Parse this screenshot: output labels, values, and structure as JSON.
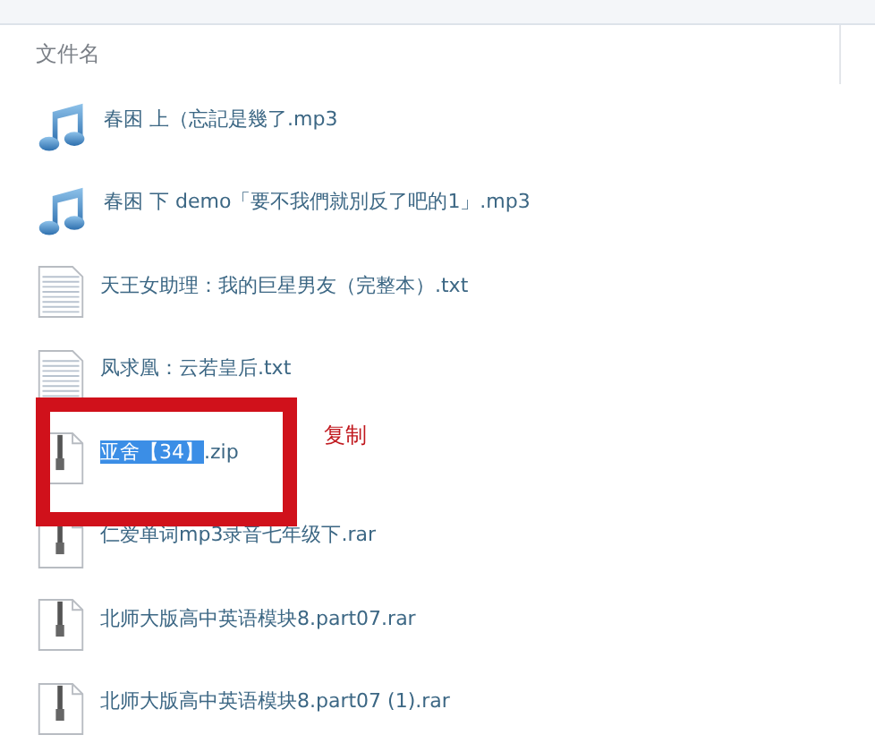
{
  "table": {
    "columns": [
      {
        "label": "文件名"
      }
    ],
    "rows": [
      {
        "kind": "audio",
        "parts": [
          {
            "text": "春困 上（忘記是幾了.mp3",
            "highlighted": false
          }
        ]
      },
      {
        "kind": "audio",
        "parts": [
          {
            "text": "春困 下 demo「要不我們就別反了吧的1」.mp3",
            "highlighted": false
          }
        ]
      },
      {
        "kind": "text",
        "parts": [
          {
            "text": "天王女助理：我的巨星男友（完整本）.txt",
            "highlighted": false
          }
        ]
      },
      {
        "kind": "text",
        "parts": [
          {
            "text": "凤求凰：云若皇后.txt",
            "highlighted": false
          }
        ]
      },
      {
        "kind": "archive",
        "parts": [
          {
            "text": "亚舍【34】",
            "highlighted": true
          },
          {
            "text": ".zip",
            "highlighted": false
          }
        ]
      },
      {
        "kind": "archive",
        "parts": [
          {
            "text": "仁爱单词mp3录音七年级下.rar",
            "highlighted": false
          }
        ]
      },
      {
        "kind": "archive",
        "parts": [
          {
            "text": "北师大版高中英语模块8.part07.rar",
            "highlighted": false
          }
        ]
      },
      {
        "kind": "archive",
        "parts": [
          {
            "text": "北师大版高中英语模块8.part07 (1).rar",
            "highlighted": false
          }
        ]
      }
    ]
  },
  "annotation": {
    "label": "复制"
  }
}
